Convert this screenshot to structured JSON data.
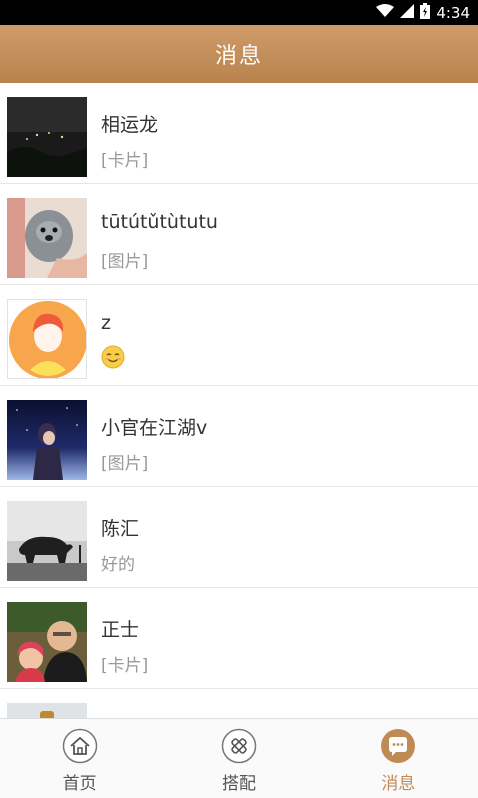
{
  "status_bar": {
    "time": "4:34",
    "wifi_icon": "wifi-icon",
    "signal_icon": "signal-icon",
    "battery_icon": "battery-icon"
  },
  "header": {
    "title": "消息"
  },
  "conversations": [
    {
      "name": "相运龙",
      "message": "[卡片]",
      "avatar_icon": "night-city-photo"
    },
    {
      "name": "tūtútǔtùtutu",
      "message": "[图片]",
      "avatar_icon": "puppy-photo"
    },
    {
      "name": "z",
      "message": "",
      "avatar_icon": "default-person-avatar",
      "emoji_icon": "smiley-emoji-icon"
    },
    {
      "name": "小官在江湖v",
      "message": "[图片]",
      "avatar_icon": "anime-night-illustration"
    },
    {
      "name": "陈汇",
      "message": "好的",
      "avatar_icon": "bear-photo"
    },
    {
      "name": "正士",
      "message": "[卡片]",
      "avatar_icon": "family-photo"
    }
  ],
  "tabs": [
    {
      "label": "首页",
      "icon": "home-icon",
      "active": false
    },
    {
      "label": "搭配",
      "icon": "match-icon",
      "active": false
    },
    {
      "label": "消息",
      "icon": "chat-icon",
      "active": true
    }
  ],
  "colors": {
    "accent": "#c08a55",
    "header_top": "#d09b69",
    "header_bottom": "#b8834e"
  }
}
